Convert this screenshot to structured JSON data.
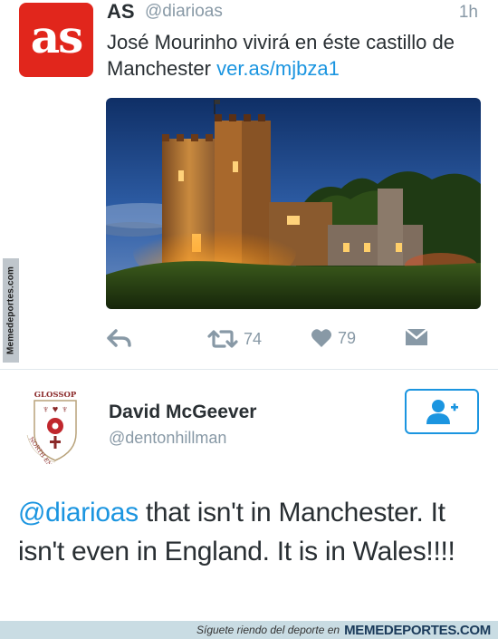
{
  "tweet1": {
    "avatar_text": "as",
    "name": "AS",
    "handle": "@diarioas",
    "time": "1h",
    "text": "José Mourinho vivirá en éste castillo de Manchester",
    "link": "ver.as/mjbza1",
    "retweets": "74",
    "likes": "79"
  },
  "tweet2": {
    "name": "David McGeever",
    "handle": "@dentonhillman",
    "crest_lettering": [
      "GLOSSOP",
      "NORTH END AFC"
    ],
    "mention": "@diarioas",
    "text": " that isn't in Manchester. It isn't even in England. It is in Wales!!!!"
  },
  "watermarks": {
    "side": "Memedeportes.com",
    "bottom_tagline": "Síguete riendo del deporte en",
    "bottom_site": "MEMEDEPORTES.COM"
  },
  "colors": {
    "link": "#1b95e0",
    "as_red": "#e1261c",
    "muted": "#8899a6",
    "text": "#292f33"
  },
  "icons": [
    "reply-icon",
    "retweet-icon",
    "heart-icon",
    "direct-message-icon",
    "follow-user-icon"
  ]
}
